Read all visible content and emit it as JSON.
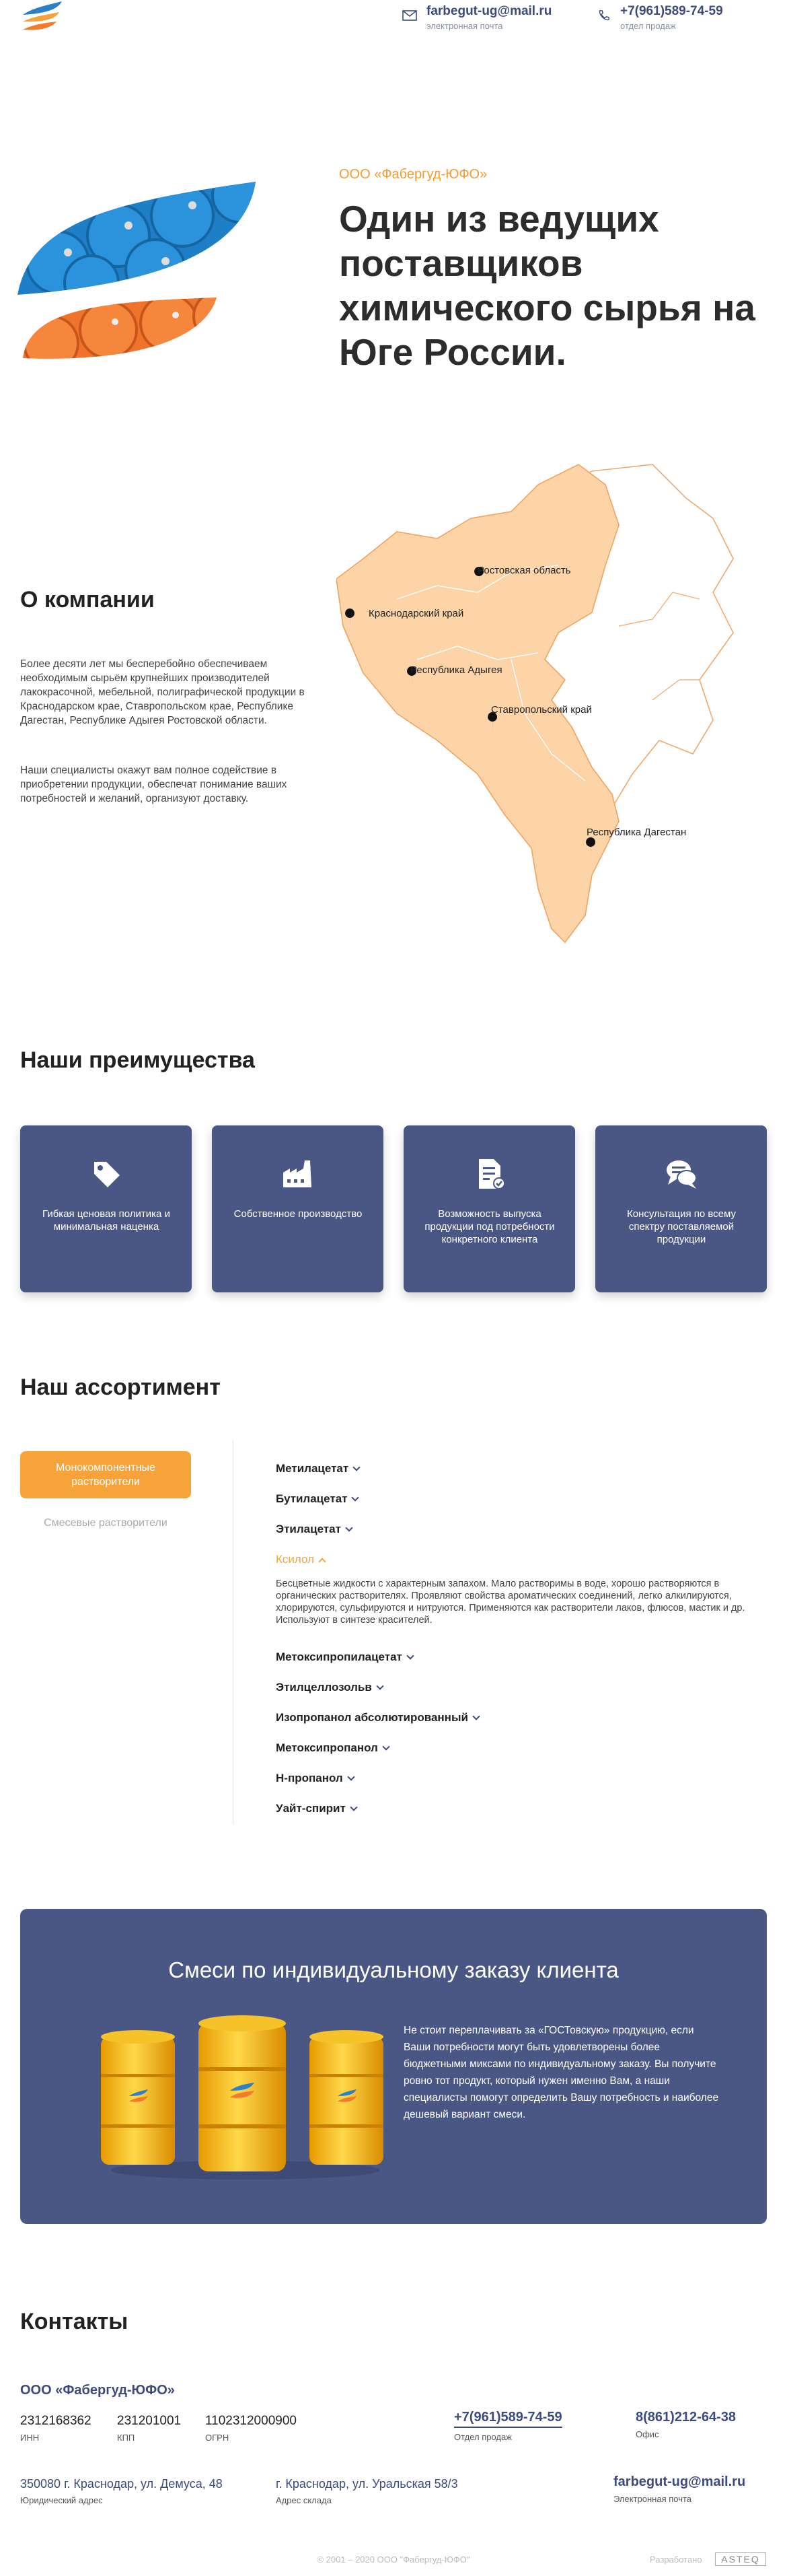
{
  "header": {
    "email": "farbegut-ug@mail.ru",
    "email_label": "электронная почта",
    "phone": "+7(961)589-74-59",
    "phone_label": "отдел продаж"
  },
  "hero": {
    "company": "ООО «Фабергуд-ЮФО»",
    "title": "Один из ведущих поставщиков химического сырья на Юге России."
  },
  "about": {
    "title": "О компании",
    "p1": "Более десяти лет мы бесперебойно обеспечиваем необходимым сырьём крупнейших производителей лакокрасочной, мебельной, полиграфической продукции в Краснодарском крае, Ставропольском крае, Республике Дагестан, Республике Адыгея Ростовской области.",
    "p2": "Наши специалисты окажут вам полное содействие в приобретении продукции, обеспечат понимание ваших потребностей и желаний, организуют доставку.",
    "map_labels": [
      "Ростовская область",
      "Краснодарский край",
      "Республика Адыгея",
      "Ставропольский край",
      "Республика Дагестан"
    ]
  },
  "advantages": {
    "title": "Наши преимущества",
    "items": [
      {
        "text": "Гибкая ценовая политика и минимальная наценка",
        "icon": "price-tag-icon"
      },
      {
        "text": "Собственное производство",
        "icon": "factory-icon"
      },
      {
        "text": "Возможность выпуска продукции под потребности конкретного клиента",
        "icon": "document-check-icon"
      },
      {
        "text": "Консультация по всему спектру поставляемой продукции",
        "icon": "chat-icon"
      }
    ]
  },
  "assortment": {
    "title": "Наш ассортимент",
    "tab_active": "Монокомпонентные растворители",
    "tab_inactive": "Смесевые растворители",
    "products": [
      "Метилацетат",
      "Бутилацетат",
      "Этилацетат",
      "Ксилол",
      "Метоксипропилацетат",
      "Этилцеллозольв",
      "Изопропанол абсолютированный",
      "Метоксипропанол",
      "Н-пропанол",
      "Уайт-спирит"
    ],
    "open_description": "Бесцветные жидкости с характерным запахом. Мало растворимы в воде, хорошо растворяются в органических растворителях. Проявляют свойства ароматических соединений, легко алкилируются, хлорируются, сульфируются и нитруются. Применяются как растворители лаков, флюсов, мастик и др. Используют в синтезе красителей."
  },
  "mix": {
    "title": "Смеси по индивидуальному заказу клиента",
    "text": "Не стоит переплачивать за «ГОСТовскую» продукцию, если Ваши потребности могут быть удовлетворены более бюджетными миксами по индивидуальному заказу. Вы получите ровно тот продукт, который нужен именно Вам, а наши специалисты помогут определить Вашу потребность и наиболее дешевый вариант смеси."
  },
  "contacts": {
    "title": "Контакты",
    "company": "ООО «Фабергуд-ЮФО»",
    "inn": "2312168362",
    "inn_label": "ИНН",
    "kpp": "231201001",
    "kpp_label": "КПП",
    "ogrn": "1102312000900",
    "ogrn_label": "ОГРН",
    "phone1": "+7(961)589-74-59",
    "phone1_label": "Отдел продаж",
    "phone2": "8(861)212-64-38",
    "phone2_label": "Офис",
    "addr1": "350080 г. Краснодар, ул. Демуса, 48",
    "addr1_label": "Юридический адрес",
    "addr2": "г. Краснодар, ул. Уральская 58/3",
    "addr2_label": "Адрес склада",
    "email": "farbegut-ug@mail.ru",
    "email_label": "Электронная почта"
  },
  "footer": {
    "copyright": "© 2001 – 2020 ООО \"Фабергуд-ЮФО\"",
    "developer": "Разработано",
    "developer_logo": "ASTEQ"
  }
}
